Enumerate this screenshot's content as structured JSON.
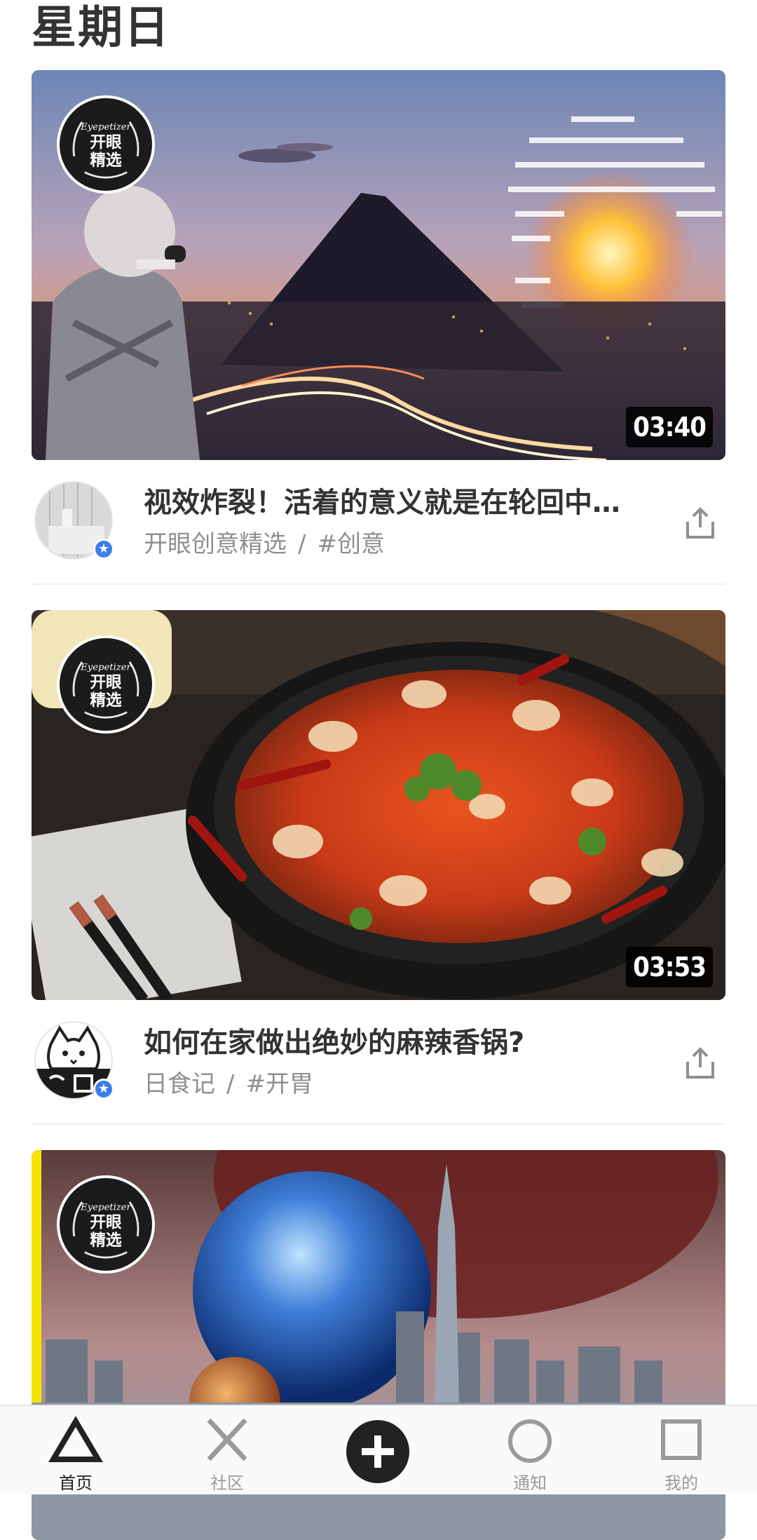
{
  "day_header": "星期日",
  "badge_text": {
    "brand": "Eyepetizer",
    "line1": "开眼",
    "line2": "精选"
  },
  "cards": [
    {
      "duration": "03:40",
      "title": "视效炸裂！活着的意义就是在轮回中…",
      "author": "开眼创意精选",
      "separator": "/",
      "tag": "#创意"
    },
    {
      "duration": "03:53",
      "title": "如何在家做出绝妙的麻辣香锅?",
      "author": "日食记",
      "separator": "/",
      "tag": "#开胃"
    },
    {}
  ],
  "tabbar": {
    "home": "首页",
    "community": "社区",
    "notifications": "通知",
    "mine": "我的"
  },
  "colors": {
    "verified": "#3d7ee6",
    "accent_yellow": "#f5e400"
  }
}
